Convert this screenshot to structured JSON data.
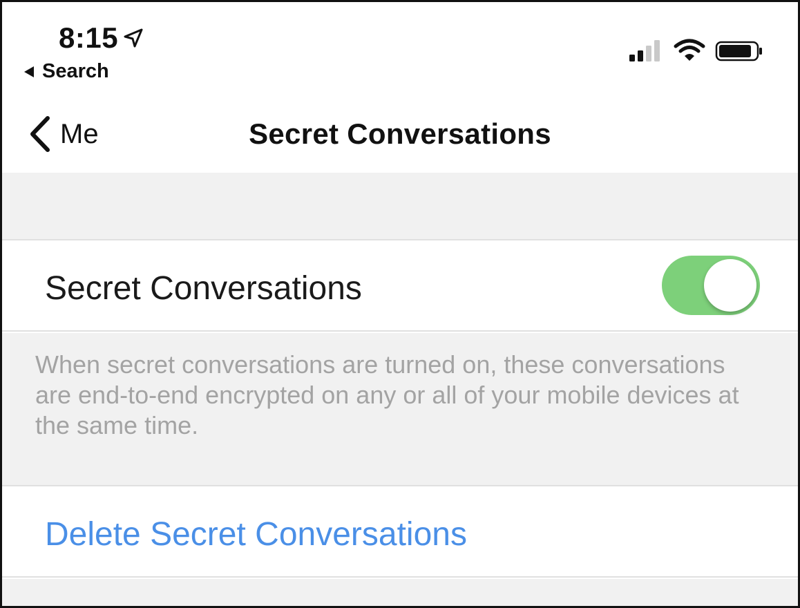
{
  "status_bar": {
    "time": "8:15",
    "location_icon": "location-arrow-icon",
    "back_app_label": "Search",
    "icons": [
      "cellular-signal-icon",
      "wifi-icon",
      "battery-icon"
    ]
  },
  "nav": {
    "back_label": "Me",
    "title": "Secret Conversations"
  },
  "settings": {
    "toggle_label": "Secret Conversations",
    "toggle_on": true,
    "description": "When secret conversations are turned on, these conversations are end-to-end encrypted on any or all of your mobile devices at the same time.",
    "delete_label": "Delete Secret Conversations"
  },
  "colors": {
    "toggle_on": "#7dd07a",
    "link_blue": "#4a8fe7",
    "footer_text": "#a3a3a3",
    "grouped_background": "#f1f1f1"
  }
}
